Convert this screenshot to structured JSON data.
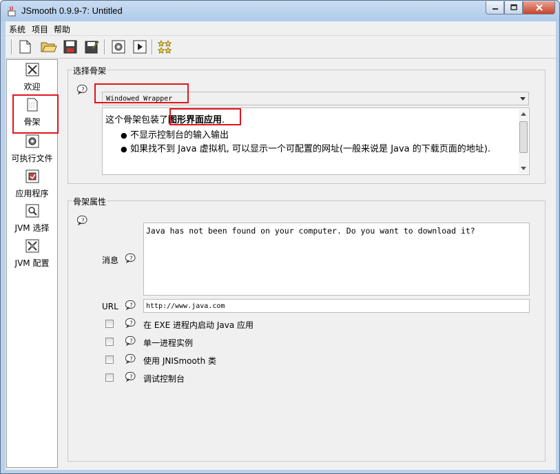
{
  "window": {
    "title": "JSmooth 0.9.9-7: Untitled"
  },
  "menu": {
    "items": [
      "系统",
      "项目",
      "帮助"
    ]
  },
  "toolbar": {
    "buttons": [
      "new-file-icon",
      "open-folder-icon",
      "save-icon",
      "save-as-icon",
      "compile-icon",
      "run-icon",
      "stars-icon"
    ]
  },
  "sidebar": {
    "items": [
      {
        "label": "欢迎",
        "icon": "welcome-icon"
      },
      {
        "label": "骨架",
        "icon": "skeleton-icon"
      },
      {
        "label": "可执行文件",
        "icon": "executable-icon"
      },
      {
        "label": "应用程序",
        "icon": "application-icon"
      },
      {
        "label": "JVM 选择",
        "icon": "jvm-select-icon"
      },
      {
        "label": "JVM 配置",
        "icon": "jvm-config-icon"
      }
    ],
    "selected": "骨架"
  },
  "skeleton_section": {
    "title": "选择骨架",
    "selected_skeleton": "Windowed Wrapper",
    "description_prefix": "这个骨架包装了",
    "description_highlight": "图形界面应用",
    "description_suffix": ".",
    "bullets": [
      "不显示控制台的输入输出",
      "如果找不到 Java 虚拟机, 可以显示一个可配置的网址(一般来说是 Java 的下载页面的地址)."
    ]
  },
  "properties_section": {
    "title": "骨架属性",
    "message_label": "消息",
    "message_value": "Java has not been found on your computer. Do you want to download it?",
    "url_label": "URL",
    "url_value": "http://www.java.com",
    "checkboxes": [
      {
        "label": "在 EXE 进程内启动 Java 应用",
        "checked": false
      },
      {
        "label": "单一进程实例",
        "checked": false
      },
      {
        "label": "使用 JNISmooth 类",
        "checked": false
      },
      {
        "label": "调试控制台",
        "checked": false
      }
    ]
  },
  "colors": {
    "highlight_border": "#e0141e",
    "title_bar": "#b9d1ea",
    "close_button": "#c7432a"
  }
}
